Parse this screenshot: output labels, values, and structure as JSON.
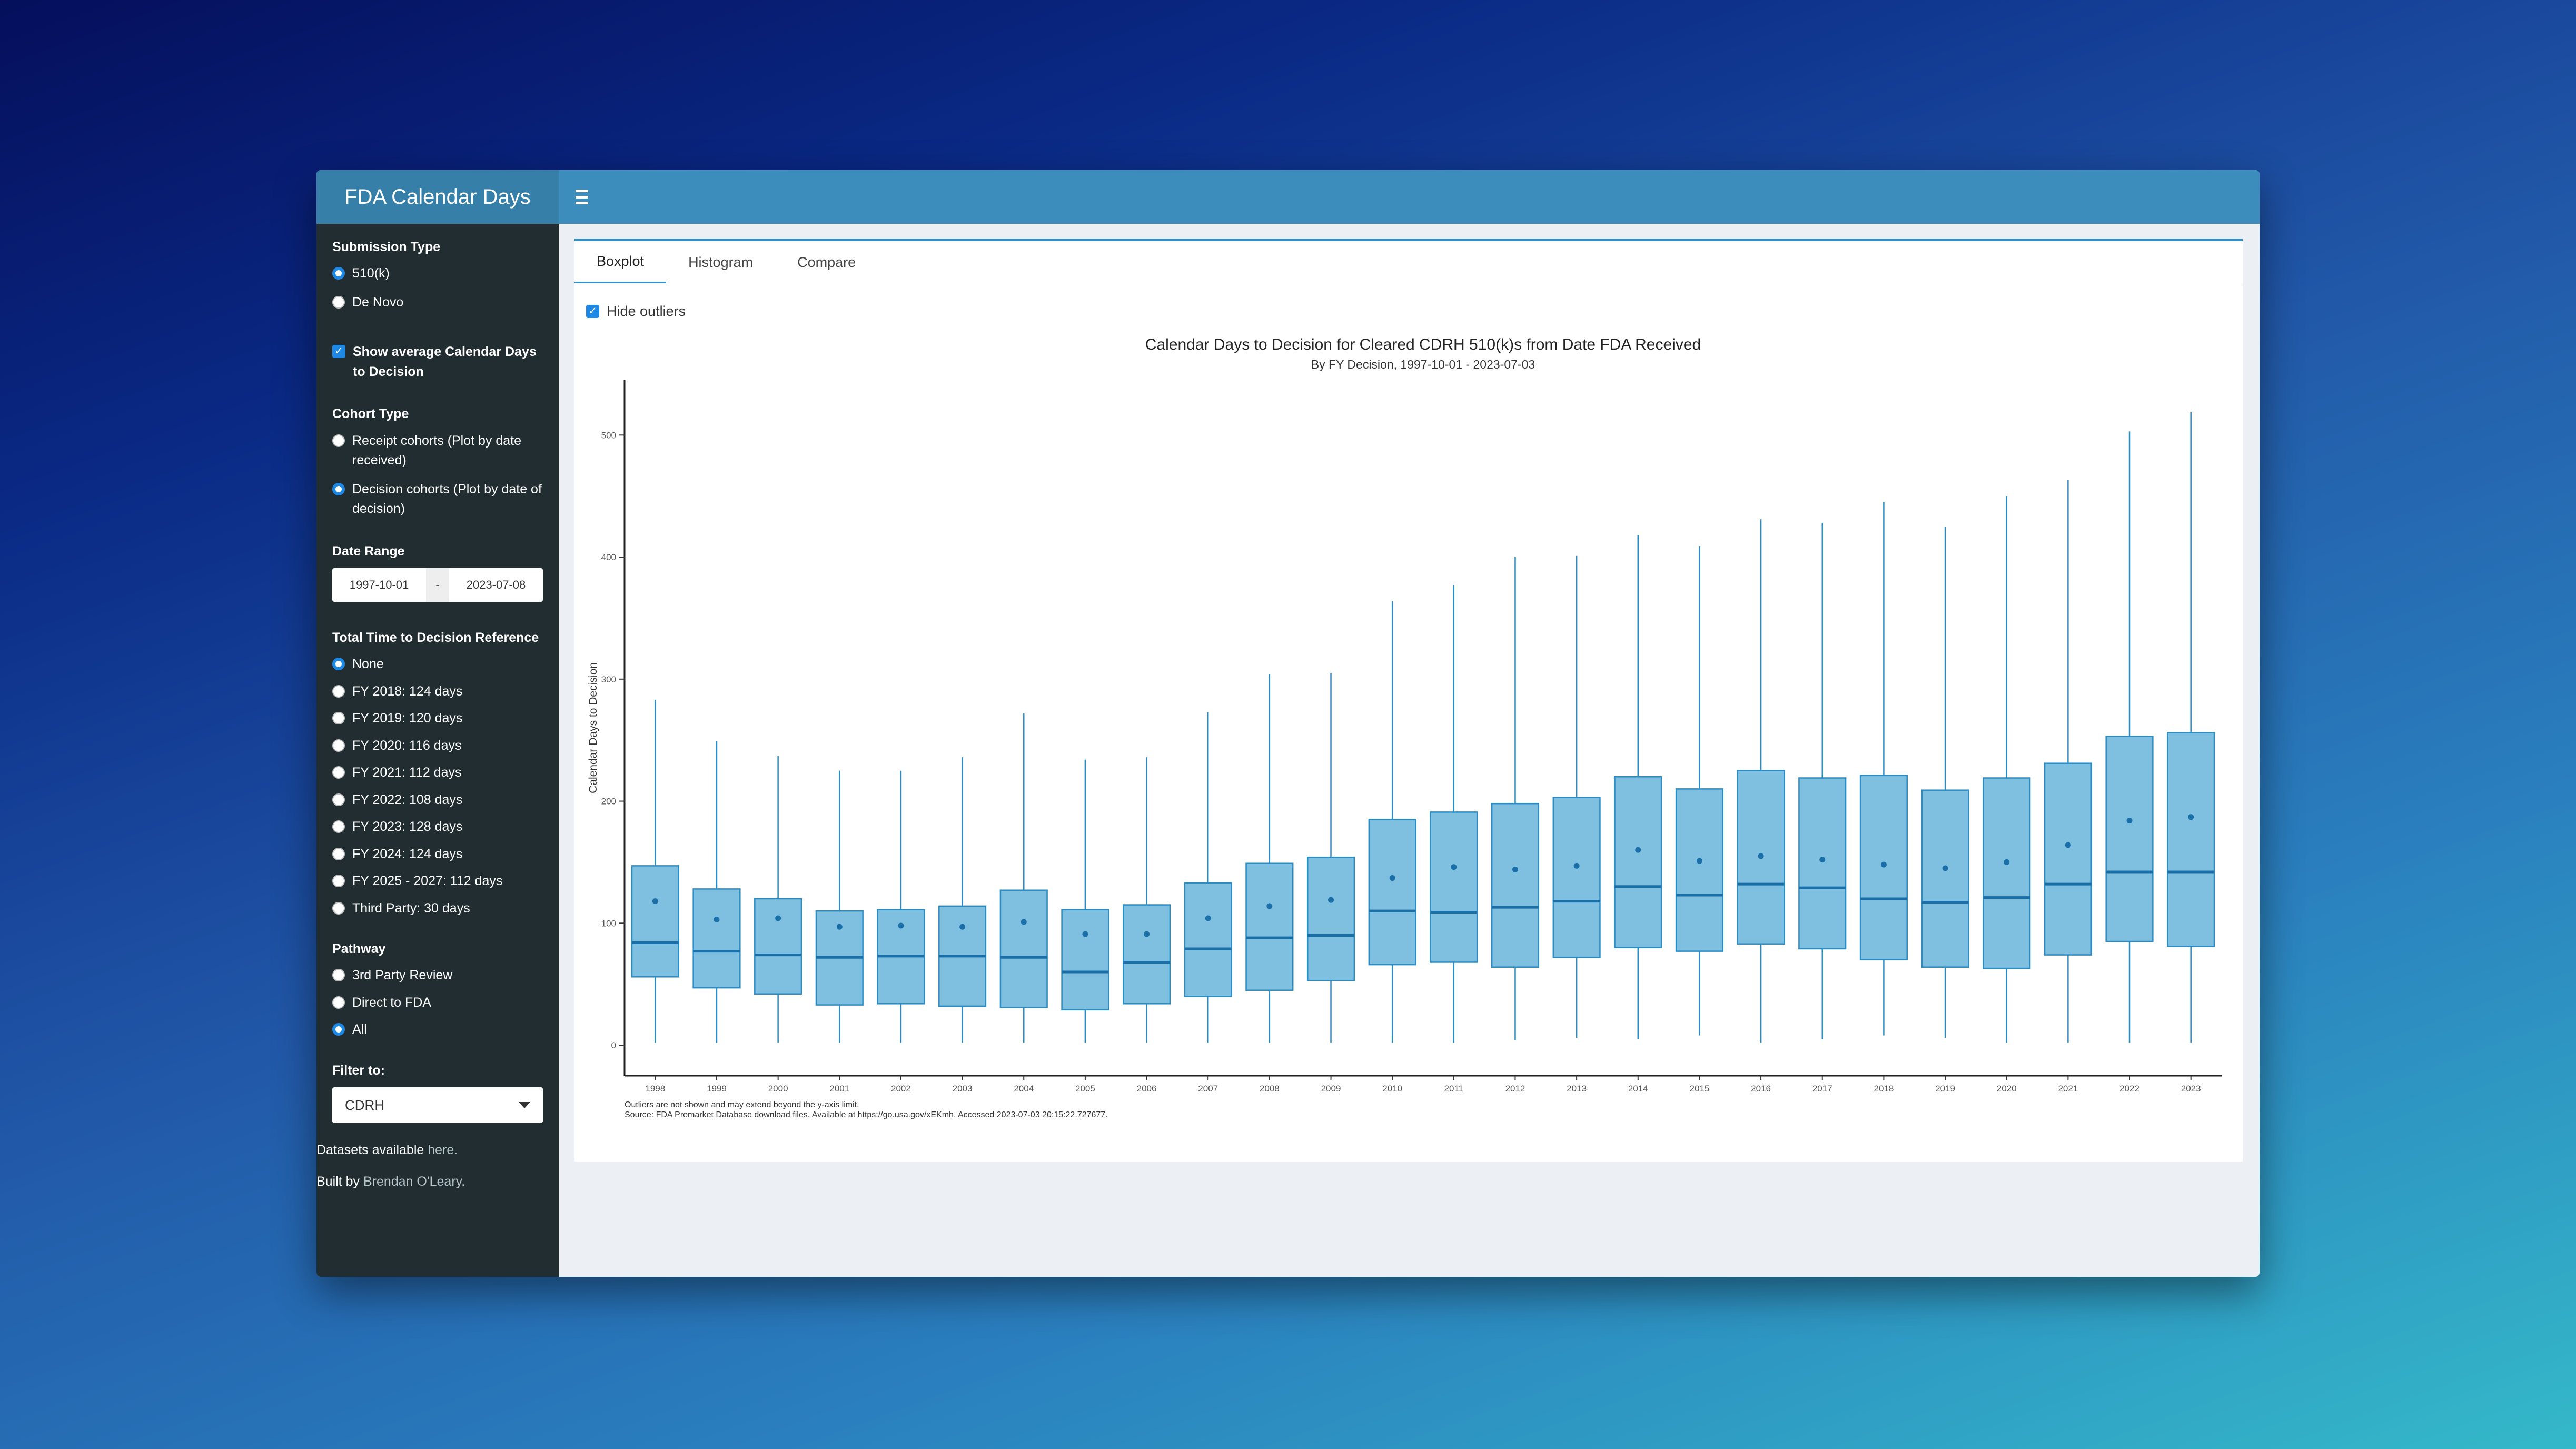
{
  "app": {
    "title": "FDA Calendar Days"
  },
  "sidebar": {
    "submission_type": {
      "label": "Submission Type",
      "options": [
        "510(k)",
        "De Novo"
      ],
      "selected": 0
    },
    "show_avg": {
      "label": "Show average Calendar Days to Decision",
      "checked": true
    },
    "cohort_type": {
      "label": "Cohort Type",
      "options": [
        "Receipt cohorts (Plot by date received)",
        "Decision cohorts (Plot by date of decision)"
      ],
      "selected": 1
    },
    "date_range": {
      "label": "Date Range",
      "start": "1997-10-01",
      "separator": "-",
      "end": "2023-07-08"
    },
    "ttd": {
      "label": "Total Time to Decision Reference",
      "options": [
        "None",
        "FY 2018: 124 days",
        "FY 2019: 120 days",
        "FY 2020: 116 days",
        "FY 2021: 112 days",
        "FY 2022: 108 days",
        "FY 2023: 128 days",
        "FY 2024: 124 days",
        "FY 2025 - 2027: 112 days",
        "Third Party: 30 days"
      ],
      "selected": 0
    },
    "pathway": {
      "label": "Pathway",
      "options": [
        "3rd Party Review",
        "Direct to FDA",
        "All"
      ],
      "selected": 2
    },
    "filter": {
      "label": "Filter to:",
      "value": "CDRH"
    },
    "datasets": {
      "prefix": "Datasets available ",
      "link": "here."
    },
    "built": {
      "prefix": "Built by ",
      "link": "Brendan O'Leary."
    }
  },
  "tabs": [
    "Boxplot",
    "Histogram",
    "Compare"
  ],
  "active_tab": 0,
  "hide_outliers": {
    "label": "Hide outliers",
    "checked": true
  },
  "colors": {
    "box_fill": "#7fbfdf",
    "box_stroke": "#2b8cc4",
    "median": "#1a6fa8"
  },
  "chart_data": {
    "type": "boxplot",
    "title": "Calendar Days to Decision for Cleared CDRH 510(k)s from Date FDA Received",
    "subtitle": "By FY Decision, 1997-10-01 - 2023-07-03",
    "ylabel": "Calendar Days to Decision",
    "xlabel": "",
    "ylim": [
      -25,
      545
    ],
    "yticks": [
      0,
      100,
      200,
      300,
      400,
      500
    ],
    "categories": [
      "1998",
      "1999",
      "2000",
      "2001",
      "2002",
      "2003",
      "2004",
      "2005",
      "2006",
      "2007",
      "2008",
      "2009",
      "2010",
      "2011",
      "2012",
      "2013",
      "2014",
      "2015",
      "2016",
      "2017",
      "2018",
      "2019",
      "2020",
      "2021",
      "2022",
      "2023"
    ],
    "boxes": [
      {
        "min": 2,
        "q1": 56,
        "median": 84,
        "q3": 147,
        "max": 283,
        "mean": 118
      },
      {
        "min": 2,
        "q1": 47,
        "median": 77,
        "q3": 128,
        "max": 249,
        "mean": 103
      },
      {
        "min": 2,
        "q1": 42,
        "median": 74,
        "q3": 120,
        "max": 237,
        "mean": 104
      },
      {
        "min": 2,
        "q1": 33,
        "median": 72,
        "q3": 110,
        "max": 225,
        "mean": 97
      },
      {
        "min": 2,
        "q1": 34,
        "median": 73,
        "q3": 111,
        "max": 225,
        "mean": 98
      },
      {
        "min": 2,
        "q1": 32,
        "median": 73,
        "q3": 114,
        "max": 236,
        "mean": 97
      },
      {
        "min": 2,
        "q1": 31,
        "median": 72,
        "q3": 127,
        "max": 272,
        "mean": 101
      },
      {
        "min": 2,
        "q1": 29,
        "median": 60,
        "q3": 111,
        "max": 234,
        "mean": 91
      },
      {
        "min": 2,
        "q1": 34,
        "median": 68,
        "q3": 115,
        "max": 236,
        "mean": 91
      },
      {
        "min": 2,
        "q1": 40,
        "median": 79,
        "q3": 133,
        "max": 273,
        "mean": 104
      },
      {
        "min": 2,
        "q1": 45,
        "median": 88,
        "q3": 149,
        "max": 304,
        "mean": 114
      },
      {
        "min": 2,
        "q1": 53,
        "median": 90,
        "q3": 154,
        "max": 305,
        "mean": 119
      },
      {
        "min": 2,
        "q1": 66,
        "median": 110,
        "q3": 185,
        "max": 364,
        "mean": 137
      },
      {
        "min": 2,
        "q1": 68,
        "median": 109,
        "q3": 191,
        "max": 377,
        "mean": 146
      },
      {
        "min": 4,
        "q1": 64,
        "median": 113,
        "q3": 198,
        "max": 400,
        "mean": 144
      },
      {
        "min": 6,
        "q1": 72,
        "median": 118,
        "q3": 203,
        "max": 401,
        "mean": 147
      },
      {
        "min": 5,
        "q1": 80,
        "median": 130,
        "q3": 220,
        "max": 418,
        "mean": 160
      },
      {
        "min": 8,
        "q1": 77,
        "median": 123,
        "q3": 210,
        "max": 409,
        "mean": 151
      },
      {
        "min": 2,
        "q1": 83,
        "median": 132,
        "q3": 225,
        "max": 431,
        "mean": 155
      },
      {
        "min": 5,
        "q1": 79,
        "median": 129,
        "q3": 219,
        "max": 428,
        "mean": 152
      },
      {
        "min": 8,
        "q1": 70,
        "median": 120,
        "q3": 221,
        "max": 445,
        "mean": 148
      },
      {
        "min": 6,
        "q1": 64,
        "median": 117,
        "q3": 209,
        "max": 425,
        "mean": 145
      },
      {
        "min": 2,
        "q1": 63,
        "median": 121,
        "q3": 219,
        "max": 450,
        "mean": 150
      },
      {
        "min": 2,
        "q1": 74,
        "median": 132,
        "q3": 231,
        "max": 463,
        "mean": 164
      },
      {
        "min": 2,
        "q1": 85,
        "median": 142,
        "q3": 253,
        "max": 503,
        "mean": 184
      },
      {
        "min": 2,
        "q1": 81,
        "median": 142,
        "q3": 256,
        "max": 519,
        "mean": 187
      }
    ],
    "show_mean": true,
    "grid": false,
    "notes": [
      "Outliers are not shown and may extend beyond the y-axis limit.",
      "Source: FDA Premarket Database download files. Available at https://go.usa.gov/xEKmh. Accessed 2023-07-03 20:15:22.727677."
    ]
  }
}
